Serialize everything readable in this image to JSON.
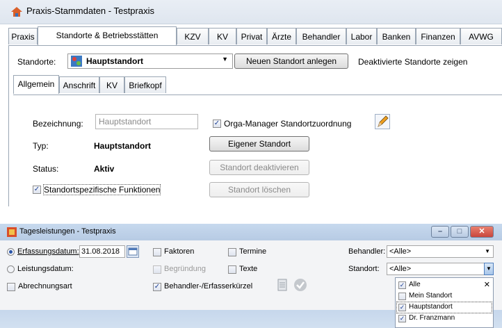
{
  "window1": {
    "title": "Praxis-Stammdaten - Testpraxis",
    "tabs": [
      "Praxis",
      "Standorte & Betriebsstätten",
      "KZV",
      "KV",
      "Privat",
      "Ärzte",
      "Behandler",
      "Labor",
      "Banken",
      "Finanzen",
      "AVWG"
    ],
    "standorte_label": "Standorte:",
    "standorte_value": "Hauptstandort",
    "new_location_button": "Neuen Standort anlegen",
    "show_inactive_link": "Deaktivierte Standorte zeigen",
    "subtabs": [
      "Allgemein",
      "Anschrift",
      "KV",
      "Briefkopf"
    ],
    "bezeichnung_label": "Bezeichnung:",
    "bezeichnung_value": "Hauptstandort",
    "orga_manager_label": "Orga-Manager Standortzuordnung",
    "typ_label": "Typ:",
    "typ_value": "Hauptstandort",
    "own_location_button": "Eigener Standort",
    "status_label": "Status:",
    "status_value": "Aktiv",
    "deactivate_button": "Standort deaktivieren",
    "specific_functions_label": "Standortspezifische Funktionen",
    "delete_button": "Standort löschen"
  },
  "window2": {
    "title": "Tagesleistungen - Testpraxis",
    "erfassungsdatum_label": "Erfassungsdatum:",
    "erfassungsdatum_value": "31.08.2018",
    "leistungsdatum_label": "Leistungsdatum:",
    "abrechnungsart_label": "Abrechnungsart",
    "faktoren_label": "Faktoren",
    "begruendung_label": "Begründung",
    "kuerzel_label": "Behandler-/Erfasserkürzel",
    "termine_label": "Termine",
    "texte_label": "Texte",
    "behandler_label": "Behandler:",
    "behandler_value": "<Alle>",
    "standort_label": "Standort:",
    "standort_value": "<Alle>",
    "dropdown_items": [
      {
        "label": "Alle",
        "checked": true
      },
      {
        "label": "Mein Standort",
        "checked": false
      },
      {
        "label": "Hauptstandort",
        "checked": true
      },
      {
        "label": "Dr. Franzmann",
        "checked": true
      }
    ]
  },
  "colors": {
    "accent": "#2a55a8",
    "title_bar": "#c7d9ee",
    "close": "#c9463d"
  }
}
